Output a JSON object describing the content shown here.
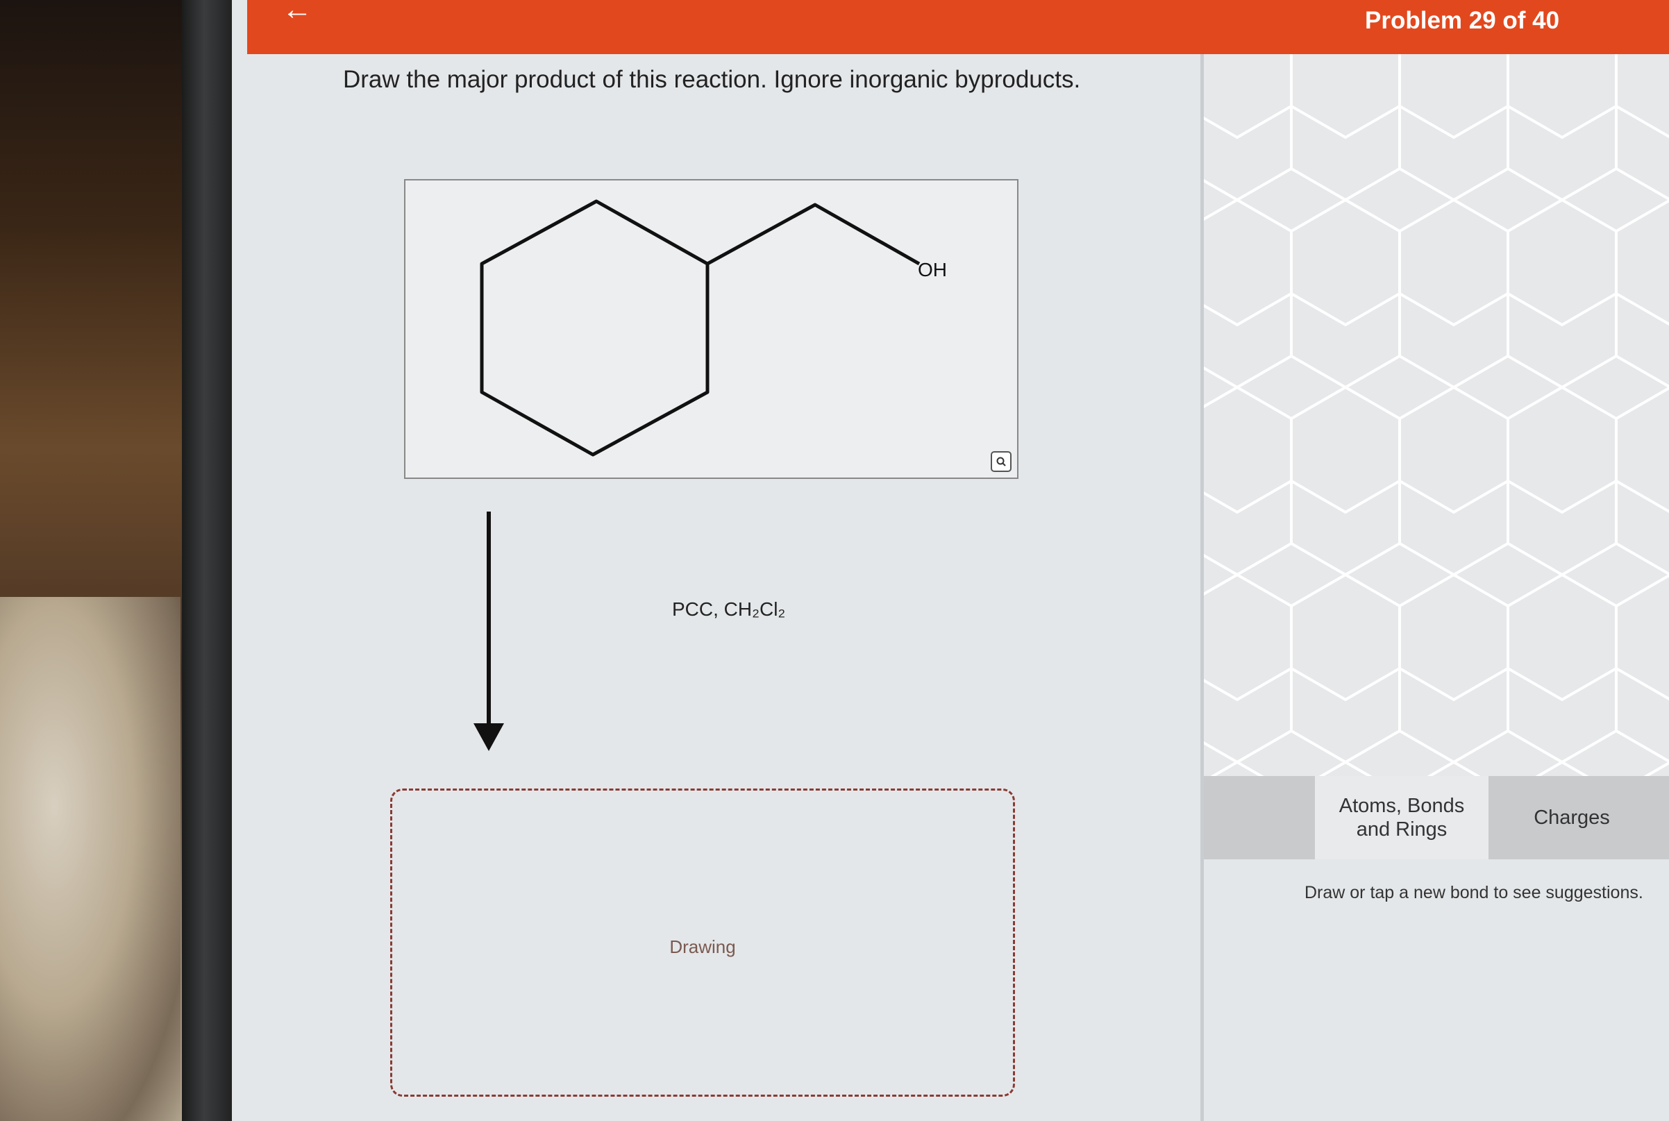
{
  "header": {
    "problem_counter": "Problem 29 of 40"
  },
  "question": {
    "text": "Draw the major product of this reaction. Ignore inorganic byproducts."
  },
  "reactant": {
    "atom_label": "OH"
  },
  "reaction": {
    "reagent": "PCC, CH₂Cl₂"
  },
  "answer_box": {
    "label": "Drawing"
  },
  "toolbar": {
    "tabs": [
      {
        "label": "Atoms, Bonds and Rings",
        "selected": true
      },
      {
        "label": "Charges",
        "selected": false
      }
    ],
    "hint": "Draw or tap a new bond to see suggestions."
  },
  "colors": {
    "header_bg": "#e2481e",
    "drawing_border": "#8a3a34"
  },
  "icons": [
    "back-arrow-icon",
    "zoom-icon"
  ]
}
